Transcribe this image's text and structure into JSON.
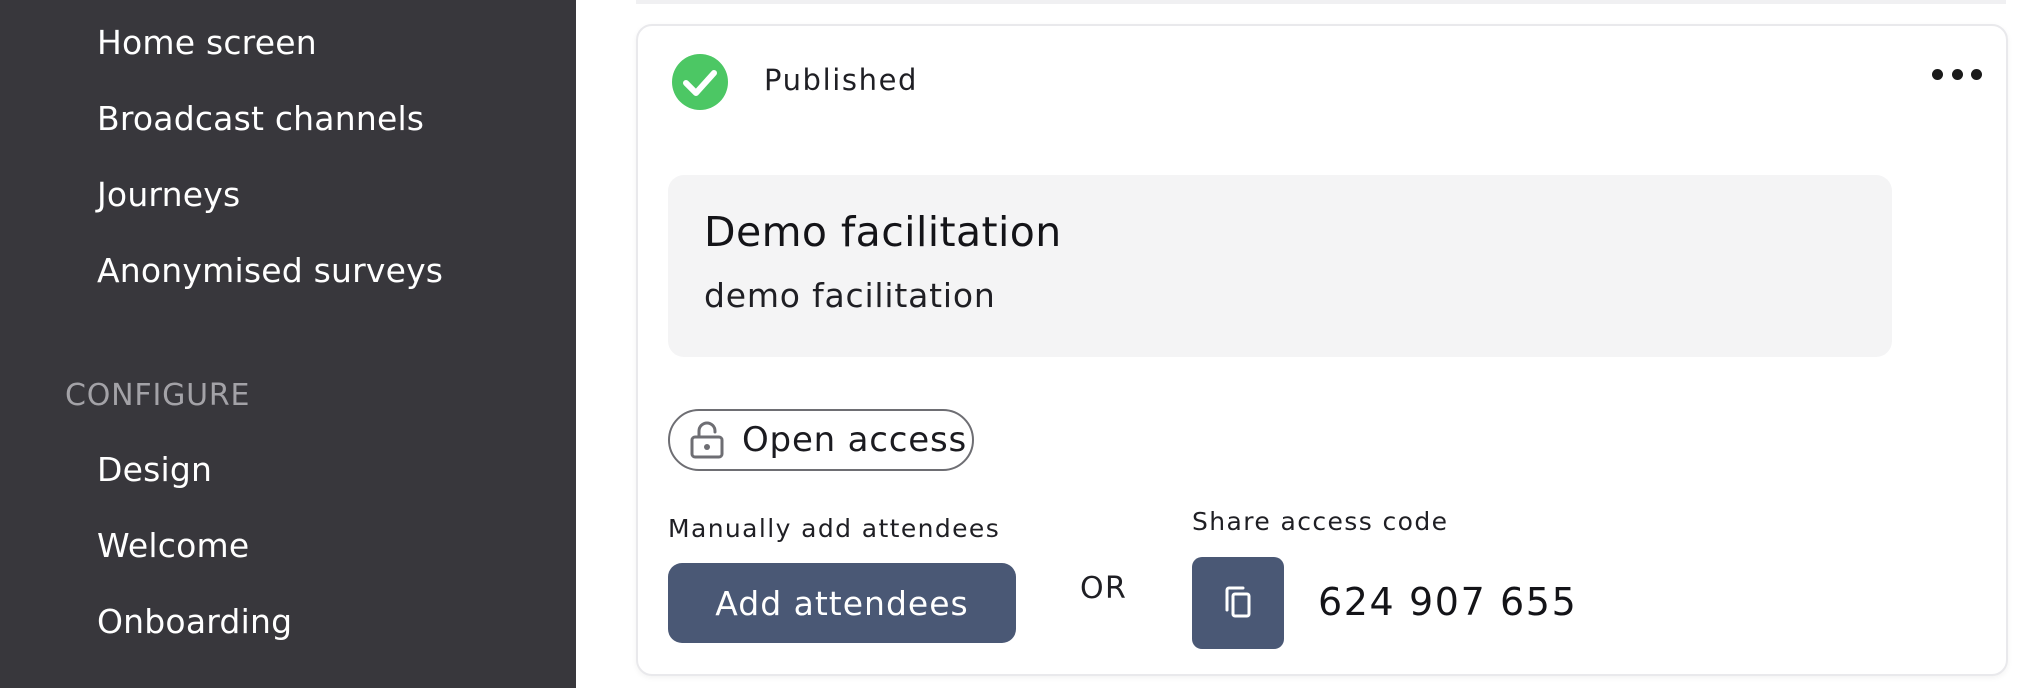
{
  "sidebar": {
    "items": [
      {
        "label": "Home screen"
      },
      {
        "label": "Broadcast channels"
      },
      {
        "label": "Journeys"
      },
      {
        "label": "Anonymised surveys"
      }
    ],
    "configure_label": "CONFIGURE",
    "configure_items": [
      {
        "label": "Design"
      },
      {
        "label": "Welcome"
      },
      {
        "label": "Onboarding"
      }
    ]
  },
  "card": {
    "status": "Published",
    "status_color": "#4cc764",
    "event_title": "Demo facilitation",
    "event_description": "demo facilitation",
    "access_label": "Open access",
    "manual_label": "Manually add attendees",
    "add_button_label": "Add attendees",
    "or_label": "OR",
    "share_label": "Share access code",
    "access_code": "624 907 655",
    "button_color": "#4a5875"
  }
}
